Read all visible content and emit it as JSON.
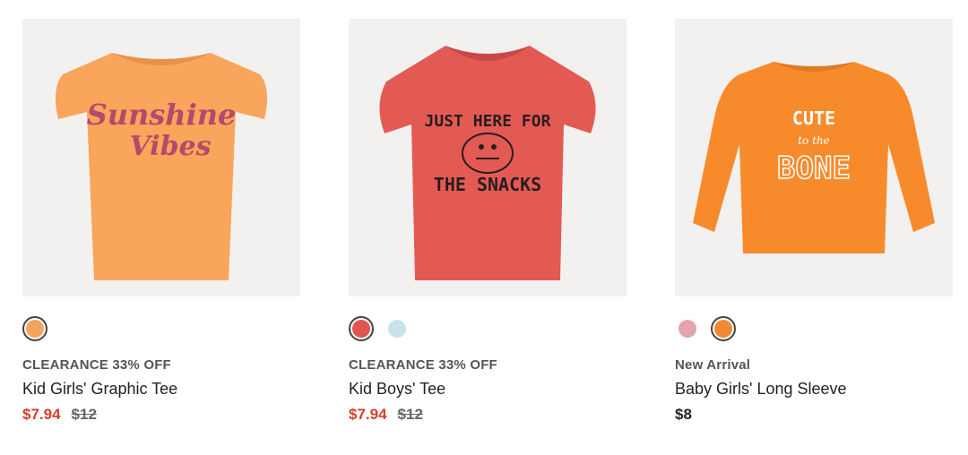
{
  "products": [
    {
      "badge": "CLEARANCE 33% OFF",
      "name": "Kid Girls' Graphic Tee",
      "sale_price": "$7.94",
      "original_price": "$12",
      "graphic_line1": "Sunshine",
      "graphic_line2": "Vibes",
      "shirt_color": "#f9a55b",
      "swatches": [
        {
          "color": "#f4a45e",
          "selected": true
        }
      ]
    },
    {
      "badge": "CLEARANCE 33% OFF",
      "name": "Kid Boys' Tee",
      "sale_price": "$7.94",
      "original_price": "$12",
      "graphic_line1": "JUST HERE FOR",
      "graphic_line2": "THE SNACKS",
      "shirt_color": "#e35a55",
      "swatches": [
        {
          "color": "#e25553",
          "selected": true
        },
        {
          "color": "#c9e3ec",
          "selected": false
        }
      ]
    },
    {
      "badge": "New Arrival",
      "name": "Baby Girls' Long Sleeve",
      "price": "$8",
      "graphic_line1": "CUTE",
      "graphic_line2": "to the",
      "graphic_line3": "BONE",
      "shirt_color": "#f78b2c",
      "swatches": [
        {
          "color": "#e3a3b2",
          "selected": false
        },
        {
          "color": "#f08a32",
          "selected": true
        }
      ]
    }
  ]
}
